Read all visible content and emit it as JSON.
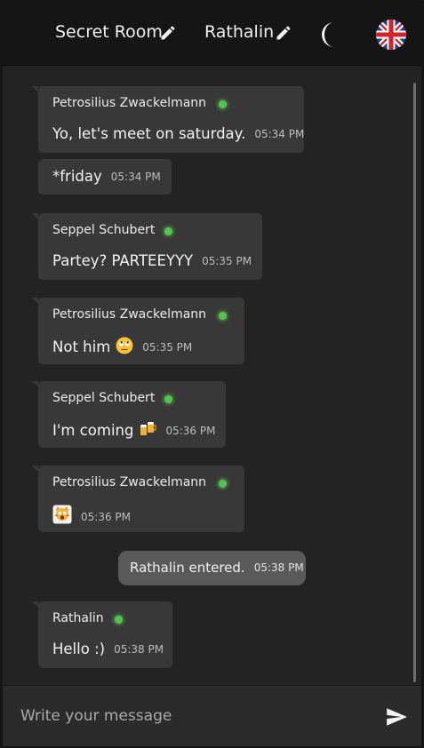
{
  "header": {
    "room_name": "Secret Room",
    "user_name": "Rathalin",
    "theme_icon": "moon-icon",
    "language_icon": "uk-flag-icon"
  },
  "messages": [
    {
      "sender": "Petrosilius Zwackelmann",
      "text": "Yo, let's meet on saturday.",
      "time": "05:34 PM"
    },
    {
      "text": "*friday",
      "time": "05:34 PM"
    },
    {
      "sender": "Seppel Schubert",
      "text": "Partey? PARTEEYYY",
      "time": "05:35 PM"
    },
    {
      "sender": "Petrosilius Zwackelmann",
      "text": "Not him",
      "emoji": "eye-roll-emoji",
      "time": "05:35 PM"
    },
    {
      "sender": "Seppel Schubert",
      "text": "I'm coming",
      "emoji": "beer-mugs-emoji",
      "time": "05:36 PM"
    },
    {
      "sender": "Petrosilius Zwackelmann",
      "emoji": "screaming-cat-emoji",
      "time": "05:36 PM"
    },
    {
      "sender": "Rathalin",
      "text": "Hello :)",
      "time": "05:38 PM"
    }
  ],
  "system_message": {
    "text": "Rathalin entered.",
    "time": "05:38 PM"
  },
  "composer": {
    "placeholder": "Write your message",
    "send_icon": "send-icon"
  },
  "colors": {
    "background": "#232323",
    "bubble": "#383838",
    "system_bubble": "#5a5a5a",
    "online": "#4fc64f"
  }
}
